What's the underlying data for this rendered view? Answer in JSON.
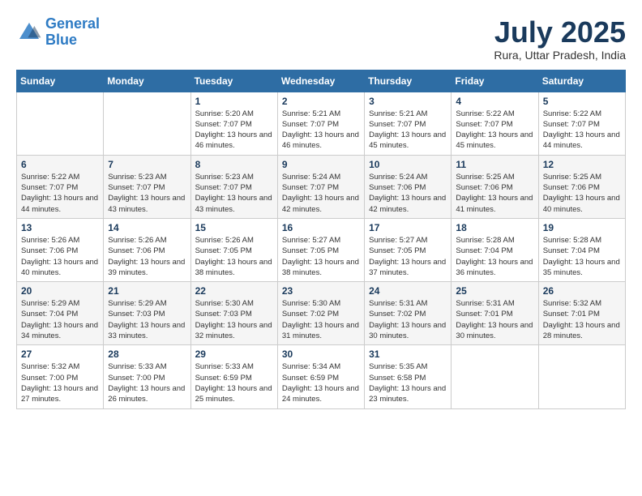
{
  "logo": {
    "line1": "General",
    "line2": "Blue"
  },
  "title": {
    "month_year": "July 2025",
    "location": "Rura, Uttar Pradesh, India"
  },
  "days_of_week": [
    "Sunday",
    "Monday",
    "Tuesday",
    "Wednesday",
    "Thursday",
    "Friday",
    "Saturday"
  ],
  "weeks": [
    [
      {
        "day": "",
        "content": ""
      },
      {
        "day": "",
        "content": ""
      },
      {
        "day": "1",
        "content": "Sunrise: 5:20 AM\nSunset: 7:07 PM\nDaylight: 13 hours and 46 minutes."
      },
      {
        "day": "2",
        "content": "Sunrise: 5:21 AM\nSunset: 7:07 PM\nDaylight: 13 hours and 46 minutes."
      },
      {
        "day": "3",
        "content": "Sunrise: 5:21 AM\nSunset: 7:07 PM\nDaylight: 13 hours and 45 minutes."
      },
      {
        "day": "4",
        "content": "Sunrise: 5:22 AM\nSunset: 7:07 PM\nDaylight: 13 hours and 45 minutes."
      },
      {
        "day": "5",
        "content": "Sunrise: 5:22 AM\nSunset: 7:07 PM\nDaylight: 13 hours and 44 minutes."
      }
    ],
    [
      {
        "day": "6",
        "content": "Sunrise: 5:22 AM\nSunset: 7:07 PM\nDaylight: 13 hours and 44 minutes."
      },
      {
        "day": "7",
        "content": "Sunrise: 5:23 AM\nSunset: 7:07 PM\nDaylight: 13 hours and 43 minutes."
      },
      {
        "day": "8",
        "content": "Sunrise: 5:23 AM\nSunset: 7:07 PM\nDaylight: 13 hours and 43 minutes."
      },
      {
        "day": "9",
        "content": "Sunrise: 5:24 AM\nSunset: 7:07 PM\nDaylight: 13 hours and 42 minutes."
      },
      {
        "day": "10",
        "content": "Sunrise: 5:24 AM\nSunset: 7:06 PM\nDaylight: 13 hours and 42 minutes."
      },
      {
        "day": "11",
        "content": "Sunrise: 5:25 AM\nSunset: 7:06 PM\nDaylight: 13 hours and 41 minutes."
      },
      {
        "day": "12",
        "content": "Sunrise: 5:25 AM\nSunset: 7:06 PM\nDaylight: 13 hours and 40 minutes."
      }
    ],
    [
      {
        "day": "13",
        "content": "Sunrise: 5:26 AM\nSunset: 7:06 PM\nDaylight: 13 hours and 40 minutes."
      },
      {
        "day": "14",
        "content": "Sunrise: 5:26 AM\nSunset: 7:06 PM\nDaylight: 13 hours and 39 minutes."
      },
      {
        "day": "15",
        "content": "Sunrise: 5:26 AM\nSunset: 7:05 PM\nDaylight: 13 hours and 38 minutes."
      },
      {
        "day": "16",
        "content": "Sunrise: 5:27 AM\nSunset: 7:05 PM\nDaylight: 13 hours and 38 minutes."
      },
      {
        "day": "17",
        "content": "Sunrise: 5:27 AM\nSunset: 7:05 PM\nDaylight: 13 hours and 37 minutes."
      },
      {
        "day": "18",
        "content": "Sunrise: 5:28 AM\nSunset: 7:04 PM\nDaylight: 13 hours and 36 minutes."
      },
      {
        "day": "19",
        "content": "Sunrise: 5:28 AM\nSunset: 7:04 PM\nDaylight: 13 hours and 35 minutes."
      }
    ],
    [
      {
        "day": "20",
        "content": "Sunrise: 5:29 AM\nSunset: 7:04 PM\nDaylight: 13 hours and 34 minutes."
      },
      {
        "day": "21",
        "content": "Sunrise: 5:29 AM\nSunset: 7:03 PM\nDaylight: 13 hours and 33 minutes."
      },
      {
        "day": "22",
        "content": "Sunrise: 5:30 AM\nSunset: 7:03 PM\nDaylight: 13 hours and 32 minutes."
      },
      {
        "day": "23",
        "content": "Sunrise: 5:30 AM\nSunset: 7:02 PM\nDaylight: 13 hours and 31 minutes."
      },
      {
        "day": "24",
        "content": "Sunrise: 5:31 AM\nSunset: 7:02 PM\nDaylight: 13 hours and 30 minutes."
      },
      {
        "day": "25",
        "content": "Sunrise: 5:31 AM\nSunset: 7:01 PM\nDaylight: 13 hours and 30 minutes."
      },
      {
        "day": "26",
        "content": "Sunrise: 5:32 AM\nSunset: 7:01 PM\nDaylight: 13 hours and 28 minutes."
      }
    ],
    [
      {
        "day": "27",
        "content": "Sunrise: 5:32 AM\nSunset: 7:00 PM\nDaylight: 13 hours and 27 minutes."
      },
      {
        "day": "28",
        "content": "Sunrise: 5:33 AM\nSunset: 7:00 PM\nDaylight: 13 hours and 26 minutes."
      },
      {
        "day": "29",
        "content": "Sunrise: 5:33 AM\nSunset: 6:59 PM\nDaylight: 13 hours and 25 minutes."
      },
      {
        "day": "30",
        "content": "Sunrise: 5:34 AM\nSunset: 6:59 PM\nDaylight: 13 hours and 24 minutes."
      },
      {
        "day": "31",
        "content": "Sunrise: 5:35 AM\nSunset: 6:58 PM\nDaylight: 13 hours and 23 minutes."
      },
      {
        "day": "",
        "content": ""
      },
      {
        "day": "",
        "content": ""
      }
    ]
  ]
}
